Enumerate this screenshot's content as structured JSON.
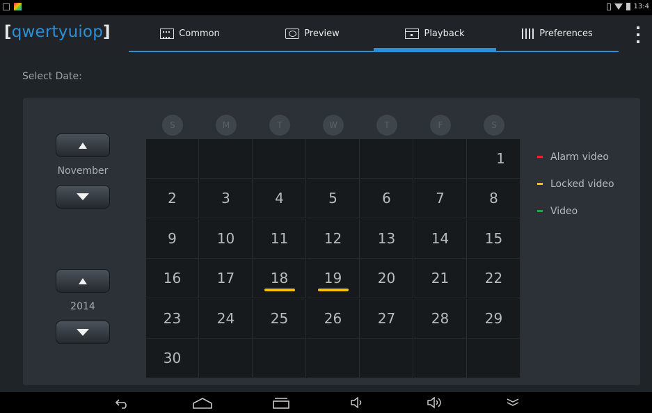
{
  "app": {
    "logo_text": "qwertyuiop"
  },
  "statusbar": {
    "time": "13:4"
  },
  "tabs": [
    {
      "label": "Common",
      "icon": "common-icon"
    },
    {
      "label": "Preview",
      "icon": "preview-icon"
    },
    {
      "label": "Playback",
      "icon": "playback-icon",
      "active": true
    },
    {
      "label": "Preferences",
      "icon": "preferences-icon"
    }
  ],
  "page": {
    "select_date_label": "Select Date:"
  },
  "month_spinner": {
    "value": "November"
  },
  "year_spinner": {
    "value": "2014"
  },
  "weekdays": [
    "S",
    "M",
    "T",
    "W",
    "T",
    "F",
    "S"
  ],
  "calendar": {
    "first_weekday_index": 6,
    "days_in_month": 30,
    "marked_days": [
      {
        "day": "18",
        "type": "locked"
      },
      {
        "day": "19",
        "type": "locked"
      }
    ]
  },
  "legend": [
    {
      "label": "Alarm video",
      "color": "#e8242f"
    },
    {
      "label": "Locked video",
      "color": "#f2c10c"
    },
    {
      "label": "Video",
      "color": "#23a53c"
    }
  ],
  "colors": {
    "accent": "#2a8fd4",
    "locked_mark": "#f2c10c"
  },
  "navbar": {
    "back_icon": "back-icon",
    "home_icon": "home-icon",
    "recents_icon": "recents-icon",
    "volume_down_icon": "volume-down-icon",
    "volume_up_icon": "volume-up-icon",
    "collapse_icon": "collapse-icon"
  }
}
